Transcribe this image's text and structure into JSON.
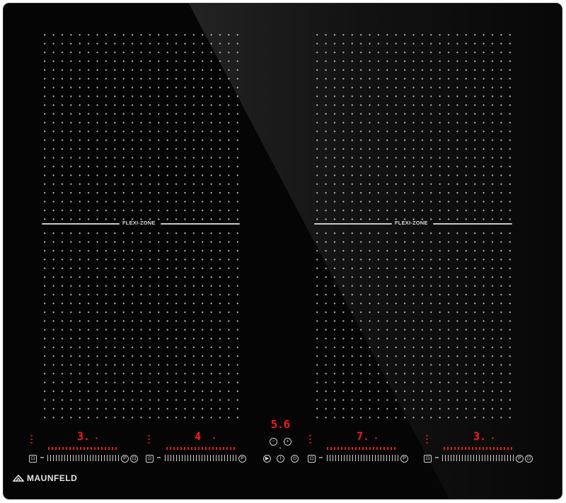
{
  "hob": {
    "brand": "MAUNFELD",
    "flexi_label": "FLEXI-ZONE",
    "timer_display": "5.6",
    "zones": [
      {
        "name": "zone-1",
        "level": "3."
      },
      {
        "name": "zone-2",
        "level": "4"
      },
      {
        "name": "zone-3",
        "level": "7."
      },
      {
        "name": "zone-4",
        "level": "3."
      }
    ],
    "glyphs": {
      "minus": "−",
      "plus": "+",
      "play": "▶",
      "power": "I",
      "lock": "⊙",
      "pause": "P",
      "boost": "⊡",
      "clock": "◔"
    },
    "colors": {
      "glass": "#050505",
      "display": "#ff2a2a",
      "print": "#cfcfcf"
    }
  }
}
